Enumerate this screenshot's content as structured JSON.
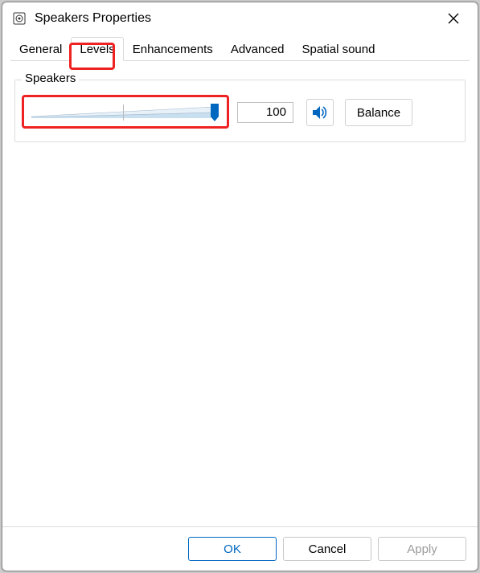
{
  "window": {
    "title": "Speakers Properties"
  },
  "tabs": {
    "general": "General",
    "levels": "Levels",
    "enhancements": "Enhancements",
    "advanced": "Advanced",
    "spatial": "Spatial sound",
    "active": "levels"
  },
  "speakers_group": {
    "label": "Speakers",
    "value": "100",
    "slider_percent": 100,
    "balance_label": "Balance"
  },
  "footer": {
    "ok": "OK",
    "cancel": "Cancel",
    "apply": "Apply"
  },
  "colors": {
    "highlight": "#ee2222",
    "accent": "#0067c0",
    "slider_fill_light": "#e8f0f8",
    "slider_fill_dark": "#c8dff0"
  }
}
